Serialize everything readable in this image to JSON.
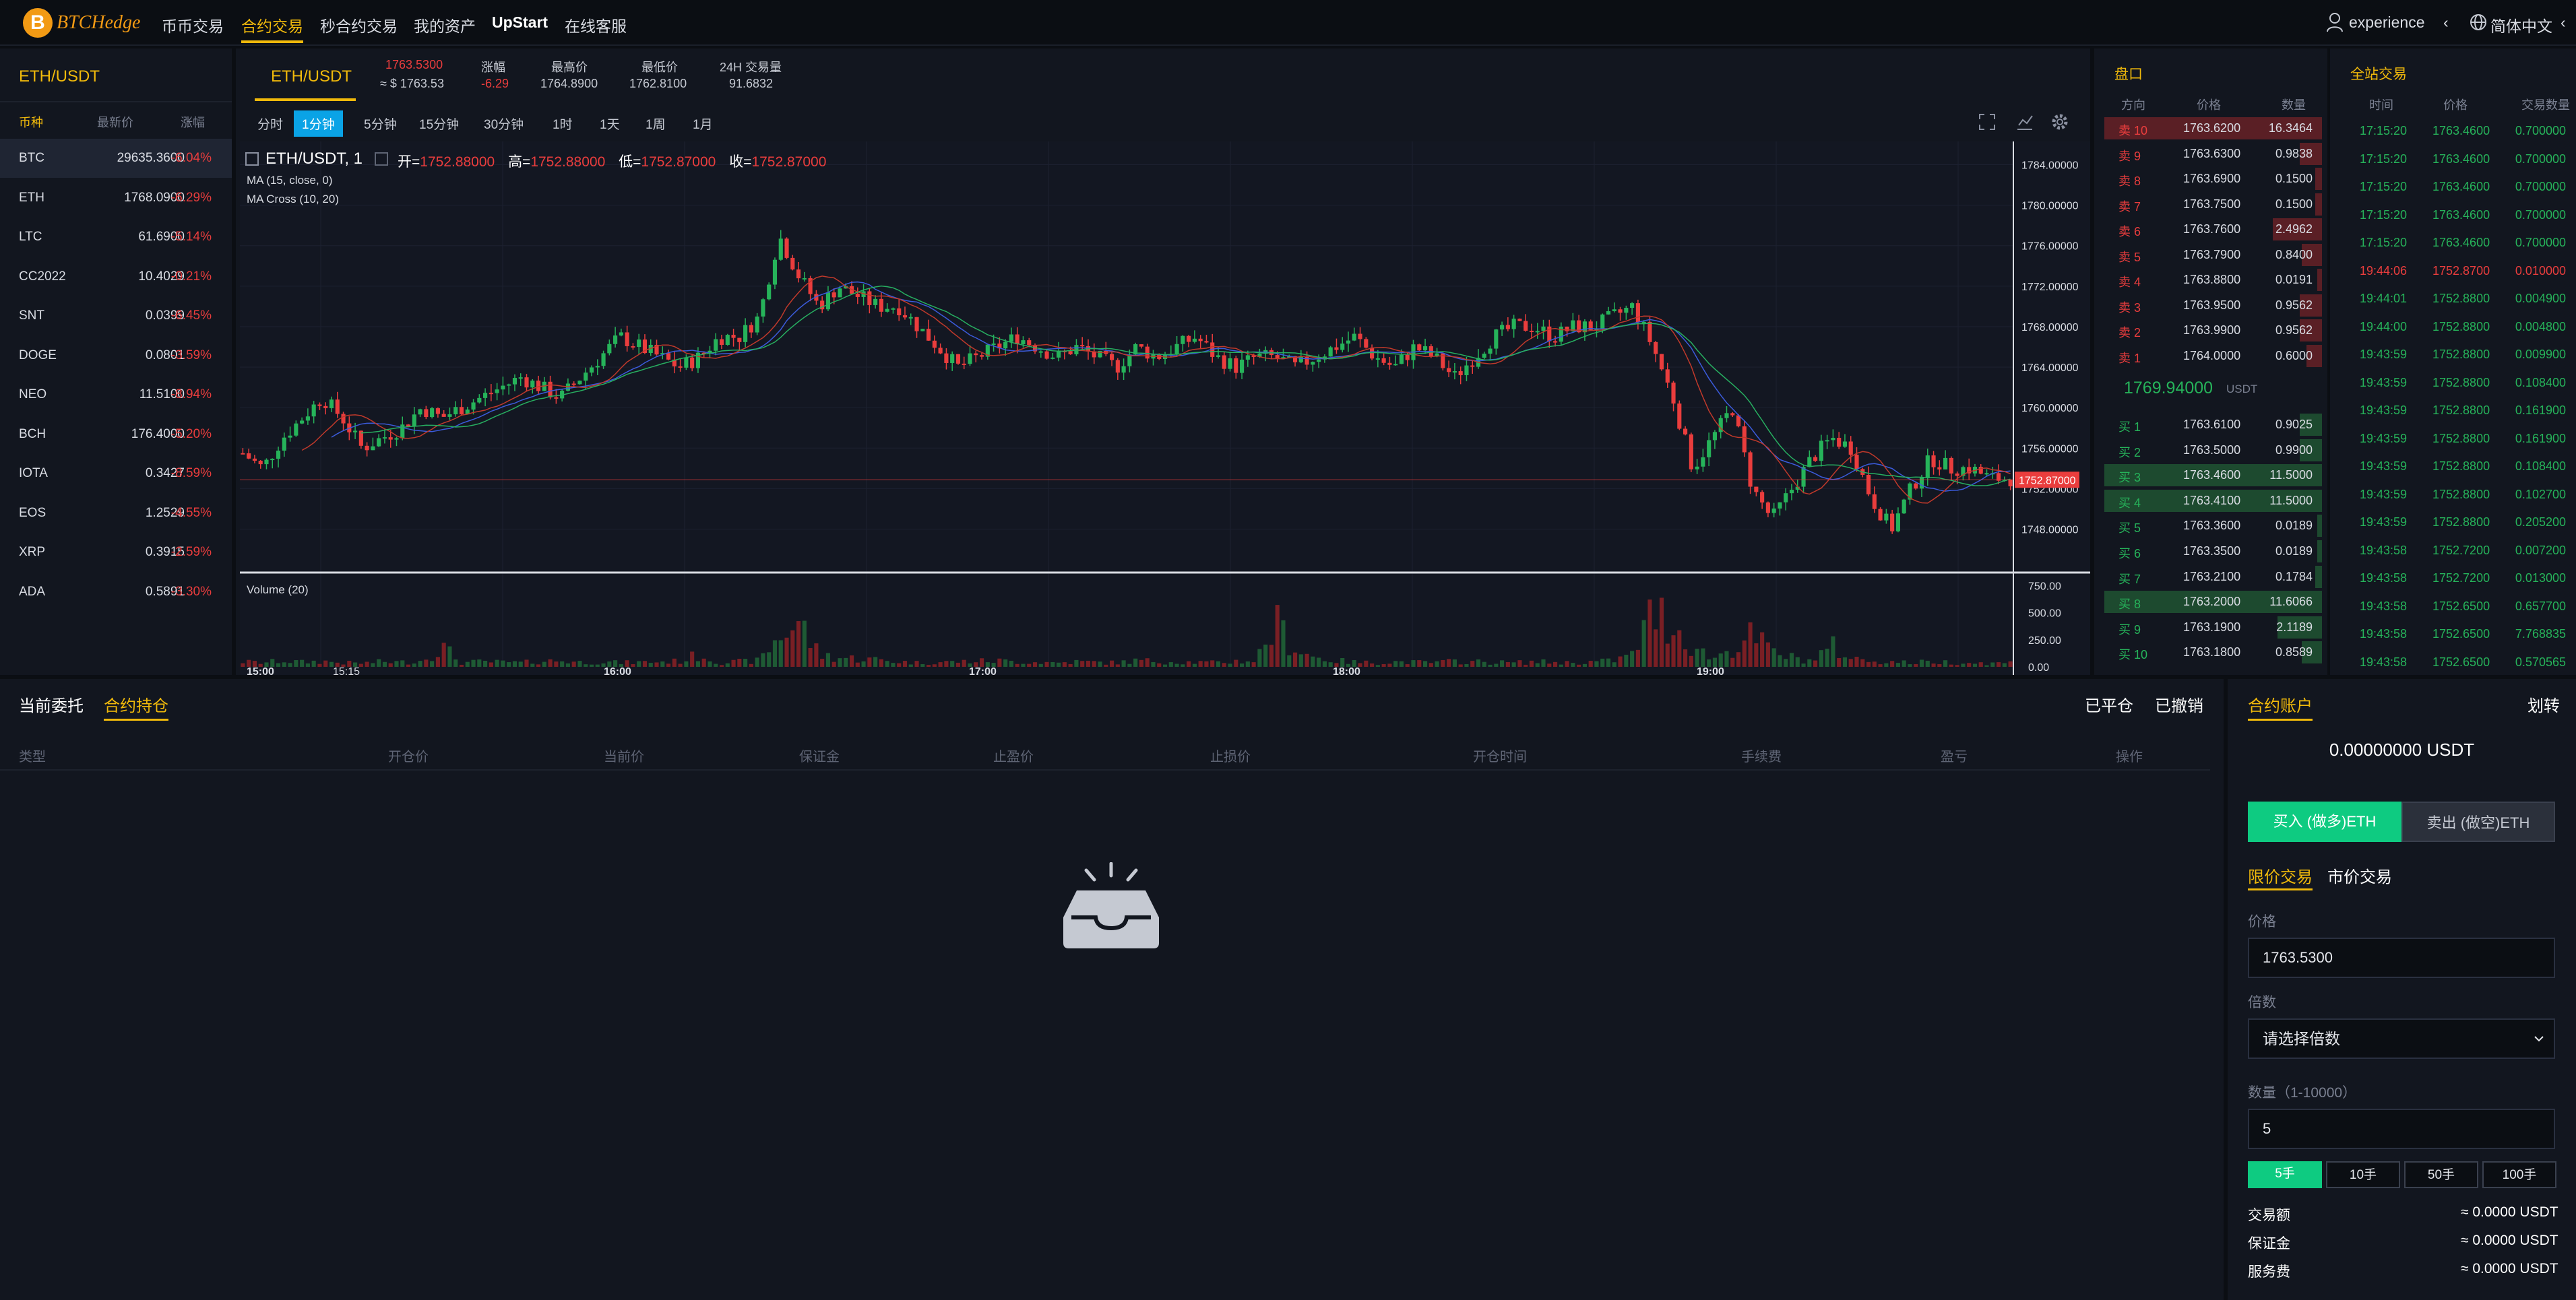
{
  "nav": {
    "logo_letter": "B",
    "logo_text": "BTCHedge",
    "items": [
      "币币交易",
      "合约交易",
      "秒合约交易",
      "我的资产",
      "UpStart",
      "在线客服"
    ],
    "user": "experience",
    "user_caret": "‹",
    "language": "简体中文",
    "language_caret": "‹"
  },
  "market": {
    "title": "ETH/USDT",
    "headers": [
      "币种",
      "最新价",
      "涨幅"
    ],
    "rows": [
      {
        "coin": "BTC",
        "price": "29635.3600",
        "change": "-6.04%"
      },
      {
        "coin": "ETH",
        "price": "1768.0900",
        "change": "-6.29%"
      },
      {
        "coin": "LTC",
        "price": "61.6900",
        "change": "-5.14%"
      },
      {
        "coin": "CC2022",
        "price": "10.4029",
        "change": "-0.21%"
      },
      {
        "coin": "SNT",
        "price": "0.0399",
        "change": "-6.45%"
      },
      {
        "coin": "DOGE",
        "price": "0.0801",
        "change": "-3.59%"
      },
      {
        "coin": "NEO",
        "price": "11.5100",
        "change": "-8.94%"
      },
      {
        "coin": "BCH",
        "price": "176.4000",
        "change": "-5.20%"
      },
      {
        "coin": "IOTA",
        "price": "0.3427",
        "change": "-8.59%"
      },
      {
        "coin": "EOS",
        "price": "1.2529",
        "change": "-4.55%"
      },
      {
        "coin": "XRP",
        "price": "0.3915",
        "change": "-2.59%"
      },
      {
        "coin": "ADA",
        "price": "0.5891",
        "change": "-3.30%"
      }
    ]
  },
  "ticker": {
    "pair": "ETH/USDT",
    "price": "1763.5300",
    "usd": "≈ $ 1763.53",
    "change_label": "涨幅",
    "change": "-6.29",
    "high_label": "最高价",
    "high": "1764.8900",
    "low_label": "最低价",
    "low": "1762.8100",
    "vol_label": "24H 交易量",
    "vol": "91.6832"
  },
  "timeframes": [
    "分时",
    "1分钟",
    "5分钟",
    "15分钟",
    "30分钟",
    "1时",
    "1天",
    "1周",
    "1月"
  ],
  "chart_legend": {
    "symbol": "ETH/USDT, 1",
    "open_label": "开=",
    "open": "1752.88000",
    "high_label": "高=",
    "high": "1752.88000",
    "low_label": "低=",
    "low": "1752.87000",
    "close_label": "收=",
    "close": "1752.87000",
    "ma": "MA (15, close, 0)",
    "macross": "MA Cross (10, 20)",
    "volume": "Volume (20)",
    "last_price_tag": "1752.87000"
  },
  "chart_data": {
    "type": "candlestick",
    "price_axis": [
      "1784.00000",
      "1780.00000",
      "1776.00000",
      "1772.00000",
      "1768.00000",
      "1764.00000",
      "1760.00000",
      "1756.00000",
      "1752.00000",
      "1748.00000"
    ],
    "volume_axis": [
      "750.00",
      "500.00",
      "250.00",
      "0.00"
    ],
    "time_axis": [
      "15:00",
      "15:15",
      "16:00",
      "17:00",
      "18:00",
      "19:00"
    ],
    "ylim": [
      1746.5,
      1785.5
    ],
    "volume_ylim": [
      0,
      760
    ],
    "close_path": [
      1755.5,
      1754,
      1757,
      1759,
      1761,
      1759,
      1756,
      1757,
      1758,
      1760,
      1759,
      1760,
      1761,
      1762,
      1763,
      1762,
      1761,
      1763,
      1765,
      1767,
      1766,
      1765,
      1764,
      1765,
      1767,
      1767,
      1769,
      1777,
      1773,
      1770,
      1772,
      1771,
      1770,
      1770,
      1768,
      1766,
      1764,
      1765,
      1766,
      1767,
      1766,
      1765,
      1766,
      1765,
      1764,
      1766,
      1765,
      1766,
      1767,
      1765,
      1764,
      1765,
      1765,
      1764,
      1765,
      1766,
      1767,
      1765,
      1764,
      1766,
      1765,
      1763,
      1765,
      1767,
      1768,
      1768,
      1767,
      1768,
      1768,
      1769,
      1770,
      1766,
      1761,
      1754,
      1757,
      1760,
      1752,
      1749,
      1752,
      1755,
      1757,
      1756,
      1751,
      1748,
      1752,
      1755,
      1754,
      1754,
      1753,
      1753
    ],
    "volume_path": [
      50,
      40,
      60,
      45,
      55,
      40,
      35,
      50,
      45,
      60,
      200,
      40,
      50,
      45,
      40,
      55,
      60,
      45,
      50,
      40,
      45,
      50,
      55,
      120,
      40,
      50,
      60,
      300,
      440,
      120,
      90,
      80,
      70,
      50,
      40,
      45,
      50,
      55,
      60,
      50,
      45,
      40,
      50,
      45,
      40,
      60,
      55,
      50,
      45,
      40,
      55,
      60,
      420,
      180,
      90,
      60,
      45,
      40,
      50,
      45,
      40,
      55,
      50,
      45,
      40,
      50,
      45,
      40,
      50,
      60,
      120,
      540,
      420,
      200,
      80,
      180,
      300,
      150,
      90,
      60,
      200,
      80,
      60,
      50,
      40,
      50,
      45,
      40,
      35,
      40
    ]
  },
  "orderbook": {
    "title": "盘口",
    "headers": [
      "方向",
      "价格",
      "数量"
    ],
    "sells": [
      {
        "label": "卖 10",
        "price": "1763.6200",
        "qty": "16.3464",
        "depth": 0.98
      },
      {
        "label": "卖 9",
        "price": "1763.6300",
        "qty": "0.9838",
        "depth": 0.1
      },
      {
        "label": "卖 8",
        "price": "1763.6900",
        "qty": "0.1500",
        "depth": 0.03
      },
      {
        "label": "卖 7",
        "price": "1763.7500",
        "qty": "0.1500",
        "depth": 0.03
      },
      {
        "label": "卖 6",
        "price": "1763.7600",
        "qty": "2.4962",
        "depth": 0.22
      },
      {
        "label": "卖 5",
        "price": "1763.7900",
        "qty": "0.8400",
        "depth": 0.09
      },
      {
        "label": "卖 4",
        "price": "1763.8800",
        "qty": "0.0191",
        "depth": 0.02
      },
      {
        "label": "卖 3",
        "price": "1763.9500",
        "qty": "0.9562",
        "depth": 0.1
      },
      {
        "label": "卖 2",
        "price": "1763.9900",
        "qty": "0.9562",
        "depth": 0.1
      },
      {
        "label": "卖 1",
        "price": "1764.0000",
        "qty": "0.6000",
        "depth": 0.07
      }
    ],
    "mid_price": "1769.94000",
    "mid_unit": "USDT",
    "buys": [
      {
        "label": "买 1",
        "price": "1763.6100",
        "qty": "0.9025",
        "depth": 0.1
      },
      {
        "label": "买 2",
        "price": "1763.5000",
        "qty": "0.9900",
        "depth": 0.1
      },
      {
        "label": "买 3",
        "price": "1763.4600",
        "qty": "11.5000",
        "depth": 0.98
      },
      {
        "label": "买 4",
        "price": "1763.4100",
        "qty": "11.5000",
        "depth": 0.98
      },
      {
        "label": "买 5",
        "price": "1763.3600",
        "qty": "0.0189",
        "depth": 0.02
      },
      {
        "label": "买 6",
        "price": "1763.3500",
        "qty": "0.0189",
        "depth": 0.02
      },
      {
        "label": "买 7",
        "price": "1763.2100",
        "qty": "0.1784",
        "depth": 0.03
      },
      {
        "label": "买 8",
        "price": "1763.2000",
        "qty": "11.6066",
        "depth": 0.98
      },
      {
        "label": "买 9",
        "price": "1763.1900",
        "qty": "2.1189",
        "depth": 0.2
      },
      {
        "label": "买 10",
        "price": "1763.1800",
        "qty": "0.8589",
        "depth": 0.09
      }
    ]
  },
  "trades": {
    "title": "全站交易",
    "headers": [
      "时间",
      "价格",
      "交易数量"
    ],
    "rows": [
      {
        "time": "17:15:20",
        "price": "1763.4600",
        "qty": "0.700000",
        "side": "buy"
      },
      {
        "time": "17:15:20",
        "price": "1763.4600",
        "qty": "0.700000",
        "side": "buy"
      },
      {
        "time": "17:15:20",
        "price": "1763.4600",
        "qty": "0.700000",
        "side": "buy"
      },
      {
        "time": "17:15:20",
        "price": "1763.4600",
        "qty": "0.700000",
        "side": "buy"
      },
      {
        "time": "17:15:20",
        "price": "1763.4600",
        "qty": "0.700000",
        "side": "buy"
      },
      {
        "time": "19:44:06",
        "price": "1752.8700",
        "qty": "0.010000",
        "side": "sell"
      },
      {
        "time": "19:44:01",
        "price": "1752.8800",
        "qty": "0.004900",
        "side": "buy"
      },
      {
        "time": "19:44:00",
        "price": "1752.8800",
        "qty": "0.004800",
        "side": "buy"
      },
      {
        "time": "19:43:59",
        "price": "1752.8800",
        "qty": "0.009900",
        "side": "buy"
      },
      {
        "time": "19:43:59",
        "price": "1752.8800",
        "qty": "0.108400",
        "side": "buy"
      },
      {
        "time": "19:43:59",
        "price": "1752.8800",
        "qty": "0.161900",
        "side": "buy"
      },
      {
        "time": "19:43:59",
        "price": "1752.8800",
        "qty": "0.161900",
        "side": "buy"
      },
      {
        "time": "19:43:59",
        "price": "1752.8800",
        "qty": "0.108400",
        "side": "buy"
      },
      {
        "time": "19:43:59",
        "price": "1752.8800",
        "qty": "0.102700",
        "side": "buy"
      },
      {
        "time": "19:43:59",
        "price": "1752.8800",
        "qty": "0.205200",
        "side": "buy"
      },
      {
        "time": "19:43:58",
        "price": "1752.7200",
        "qty": "0.007200",
        "side": "buy"
      },
      {
        "time": "19:43:58",
        "price": "1752.7200",
        "qty": "0.013000",
        "side": "buy"
      },
      {
        "time": "19:43:58",
        "price": "1752.6500",
        "qty": "0.657700",
        "side": "buy"
      },
      {
        "time": "19:43:58",
        "price": "1752.6500",
        "qty": "7.768835",
        "side": "buy"
      },
      {
        "time": "19:43:58",
        "price": "1752.6500",
        "qty": "0.570565",
        "side": "buy"
      }
    ]
  },
  "positions": {
    "tab_orders": "当前委托",
    "tab_positions": "合约持仓",
    "closed": "已平仓",
    "cancelled": "已撤销",
    "columns": [
      "类型",
      "开仓价",
      "当前价",
      "保证金",
      "止盈价",
      "止损价",
      "开仓时间",
      "手续费",
      "盈亏",
      "操作"
    ]
  },
  "account": {
    "title": "合约账户",
    "transfer": "划转",
    "balance": "0.00000000 USDT",
    "buy_btn": "买入 (做多)ETH",
    "sell_btn": "卖出 (做空)ETH",
    "limit_tab": "限价交易",
    "market_tab": "市价交易",
    "price_label": "价格",
    "price_value": "1763.5300",
    "leverage_label": "倍数",
    "leverage_placeholder": "请选择倍数",
    "qty_label": "数量（1-10000）",
    "qty_value": "5",
    "lots": [
      "5手",
      "10手",
      "50手",
      "100手"
    ],
    "amount_label": "交易额",
    "amount_value": "≈ 0.0000 USDT",
    "margin_label": "保证金",
    "margin_value": "≈ 0.0000 USDT",
    "fee_label": "服务费",
    "fee_value": "≈ 0.0000 USDT"
  },
  "colors": {
    "up": "#26b35a",
    "down": "#ea3d3d",
    "accent": "#f0b90b",
    "buy_btn": "#0ecb81",
    "tab_active": "#0aa3e6"
  }
}
